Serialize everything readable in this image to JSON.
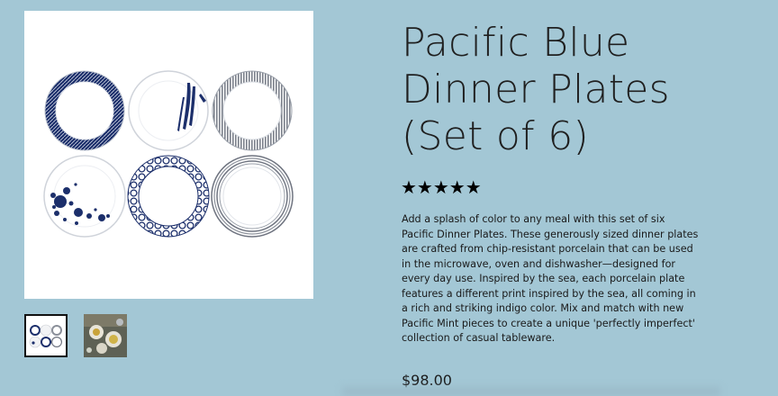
{
  "product": {
    "title": "Pacific Blue Dinner Plates (Set of 6)",
    "rating_stars": "★★★★★",
    "rating_value": 5,
    "description": "Add a splash of color to any meal with this set of six Pacific Dinner Plates. These generously sized dinner plates are crafted from chip-resistant porcelain that can be used in the microwave, oven and dishwasher—designed for every day use. Inspired by the sea, each porcelain plate features a different print inspired by the sea, all coming in a rich and striking indigo color. Mix and match with new Pacific Mint pieces to create a unique 'perfectly imperfect' collection of casual tableware.",
    "price": "$98.00"
  },
  "gallery": {
    "thumbnails": [
      {
        "name": "plates-set-thumbnail",
        "selected": true
      },
      {
        "name": "table-setting-thumbnail",
        "selected": false
      }
    ]
  },
  "colors": {
    "background": "#a3c7d5",
    "indigo": "#1c2f6b",
    "text": "#1a1a1a"
  }
}
